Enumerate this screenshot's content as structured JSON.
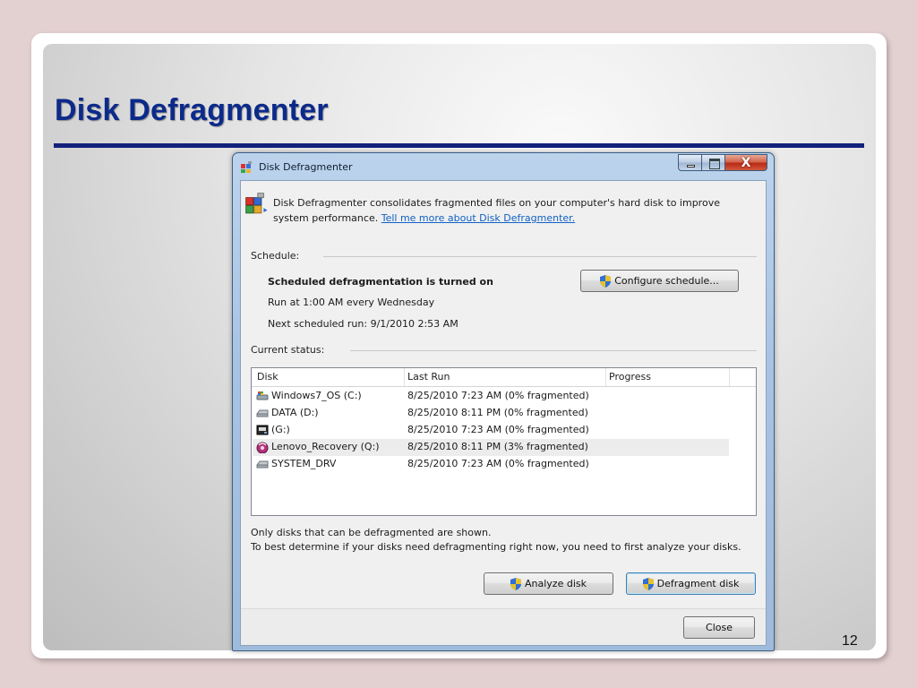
{
  "slide": {
    "title": "Disk Defragmenter",
    "page_number": "12"
  },
  "window": {
    "title": "Disk Defragmenter",
    "close_glyph": "X",
    "intro_text": "Disk Defragmenter consolidates fragmented files on your computer's hard disk to improve system performance.",
    "intro_link": "Tell me more about Disk Defragmenter.",
    "schedule": {
      "label": "Schedule:",
      "status": "Scheduled defragmentation is turned on",
      "run_at": "Run at 1:00 AM every Wednesday",
      "next_run": "Next scheduled run: 9/1/2010 2:53 AM",
      "configure_button": "Configure schedule..."
    },
    "current_status": {
      "label": "Current status:",
      "columns": [
        "Disk",
        "Last Run",
        "Progress"
      ],
      "rows": [
        {
          "disk": "Windows7_OS (C:)",
          "last_run": "8/25/2010 7:23 AM (0% fragmented)",
          "progress": "",
          "icon": "system-drive-icon",
          "selected": false
        },
        {
          "disk": "DATA (D:)",
          "last_run": "8/25/2010 8:11 PM (0% fragmented)",
          "progress": "",
          "icon": "hard-drive-icon",
          "selected": false
        },
        {
          "disk": "(G:)",
          "last_run": "8/25/2010 7:23 AM (0% fragmented)",
          "progress": "",
          "icon": "removable-drive-icon",
          "selected": false
        },
        {
          "disk": "Lenovo_Recovery (Q:)",
          "last_run": "8/25/2010 8:11 PM (3% fragmented)",
          "progress": "",
          "icon": "recovery-drive-icon",
          "selected": true
        },
        {
          "disk": "SYSTEM_DRV",
          "last_run": "8/25/2010 7:23 AM (0% fragmented)",
          "progress": "",
          "icon": "hard-drive-icon",
          "selected": false
        }
      ]
    },
    "notes": {
      "line1": "Only disks that can be defragmented are shown.",
      "line2": "To best determine if your disks need defragmenting right now, you need to first analyze your disks."
    },
    "buttons": {
      "analyze": "Analyze disk",
      "defragment": "Defragment disk",
      "close": "Close"
    }
  },
  "colors": {
    "title_text": "#0c2a8a",
    "title_rule": "#12217a",
    "link": "#0f61c5",
    "close_button": "#c8341c"
  }
}
